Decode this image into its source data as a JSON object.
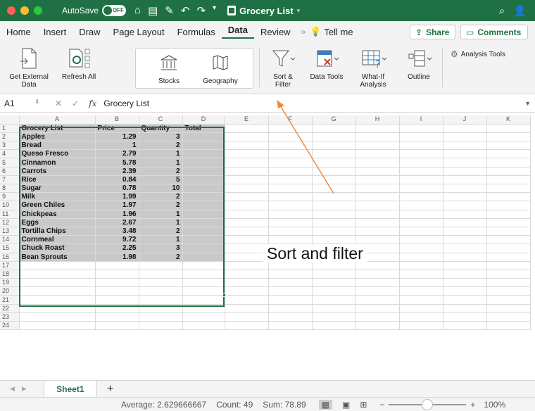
{
  "titlebar": {
    "autosave_label": "AutoSave",
    "autosave_state": "OFF",
    "doc_title": "Grocery List",
    "colors": {
      "bg": "#1f7145",
      "close": "#ff5f57",
      "min": "#febc2e",
      "max": "#28c840"
    }
  },
  "tabs": [
    {
      "label": "Home"
    },
    {
      "label": "Insert"
    },
    {
      "label": "Draw"
    },
    {
      "label": "Page Layout"
    },
    {
      "label": "Formulas"
    },
    {
      "label": "Data",
      "active": true
    },
    {
      "label": "Review"
    }
  ],
  "tell_me": "Tell me",
  "share_label": "Share",
  "comments_label": "Comments",
  "ribbon": {
    "get_external": "Get External Data",
    "refresh_all": "Refresh All",
    "stocks": "Stocks",
    "geography": "Geography",
    "sort_filter": "Sort & Filter",
    "data_tools": "Data Tools",
    "what_if": "What-If Analysis",
    "outline": "Outline",
    "analysis_tools": "Analysis Tools"
  },
  "formula_bar": {
    "name_box": "A1",
    "fx": "fx",
    "value": "Grocery List"
  },
  "columns": [
    "A",
    "B",
    "C",
    "D",
    "E",
    "F",
    "G",
    "H",
    "I",
    "J",
    "K"
  ],
  "header_row": [
    "Grocery List",
    "Price",
    "Quantity",
    "Total"
  ],
  "rows": [
    {
      "item": "Apples",
      "price": "1.29",
      "qty": "3"
    },
    {
      "item": "Bread",
      "price": "1",
      "qty": "2"
    },
    {
      "item": "Queso Fresco",
      "price": "2.79",
      "qty": "1"
    },
    {
      "item": "Cinnamon",
      "price": "5.78",
      "qty": "1"
    },
    {
      "item": "Carrots",
      "price": "2.39",
      "qty": "2"
    },
    {
      "item": "Rice",
      "price": "0.84",
      "qty": "5"
    },
    {
      "item": "Sugar",
      "price": "0.78",
      "qty": "10"
    },
    {
      "item": "Milk",
      "price": "1.99",
      "qty": "2"
    },
    {
      "item": "Green Chiles",
      "price": "1.97",
      "qty": "2"
    },
    {
      "item": "Chickpeas",
      "price": "1.96",
      "qty": "1"
    },
    {
      "item": "Eggs",
      "price": "2.67",
      "qty": "1"
    },
    {
      "item": "Tortilla Chips",
      "price": "3.48",
      "qty": "2"
    },
    {
      "item": "Cornmeal",
      "price": "9.72",
      "qty": "1"
    },
    {
      "item": "Chuck Roast",
      "price": "2.25",
      "qty": "3"
    },
    {
      "item": "Bean Sprouts",
      "price": "1.98",
      "qty": "2"
    }
  ],
  "row_numbers": [
    "1",
    "2",
    "3",
    "4",
    "5",
    "6",
    "7",
    "8",
    "9",
    "10",
    "11",
    "12",
    "13",
    "14",
    "15",
    "16",
    "17",
    "18",
    "19",
    "20",
    "21",
    "22",
    "23",
    "24"
  ],
  "annotation": "Sort and filter",
  "annotation_color": "#f28a3a",
  "sheet_tab": "Sheet1",
  "status": {
    "average": "Average: 2.629666667",
    "count": "Count: 49",
    "sum": "Sum: 78.89",
    "zoom": "100%"
  }
}
